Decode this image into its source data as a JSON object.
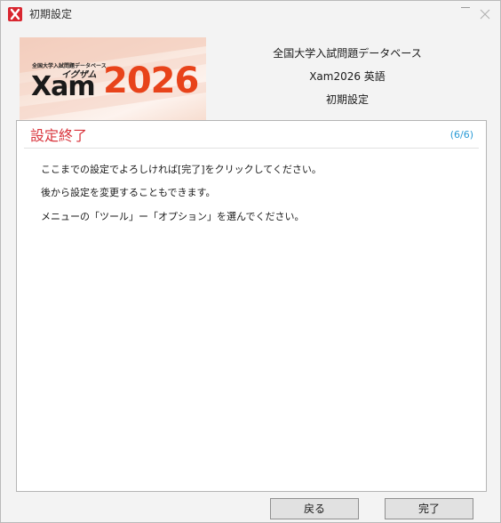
{
  "window": {
    "title": "初期設定"
  },
  "banner": {
    "small_text": "全国大学入試問題データベース",
    "katakana": "イグザム",
    "xam": "Xam",
    "year": "2026",
    "accent_color": "#e8431a"
  },
  "info": {
    "line1": "全国大学入試問題データベース",
    "line2": "Xam2026 英語",
    "line3": "初期設定"
  },
  "panel": {
    "title": "設定終了",
    "step": "(6/6)",
    "messages": [
      "ここまでの設定でよろしければ[完了]をクリックしてください。",
      "後から設定を変更することもできます。",
      "メニューの「ツール」ー「オプション」を選んでください。"
    ]
  },
  "buttons": {
    "back": "戻る",
    "done": "完了"
  },
  "icons": {
    "app": "app-x-icon",
    "minimize": "minimize-icon",
    "close": "close-icon"
  }
}
